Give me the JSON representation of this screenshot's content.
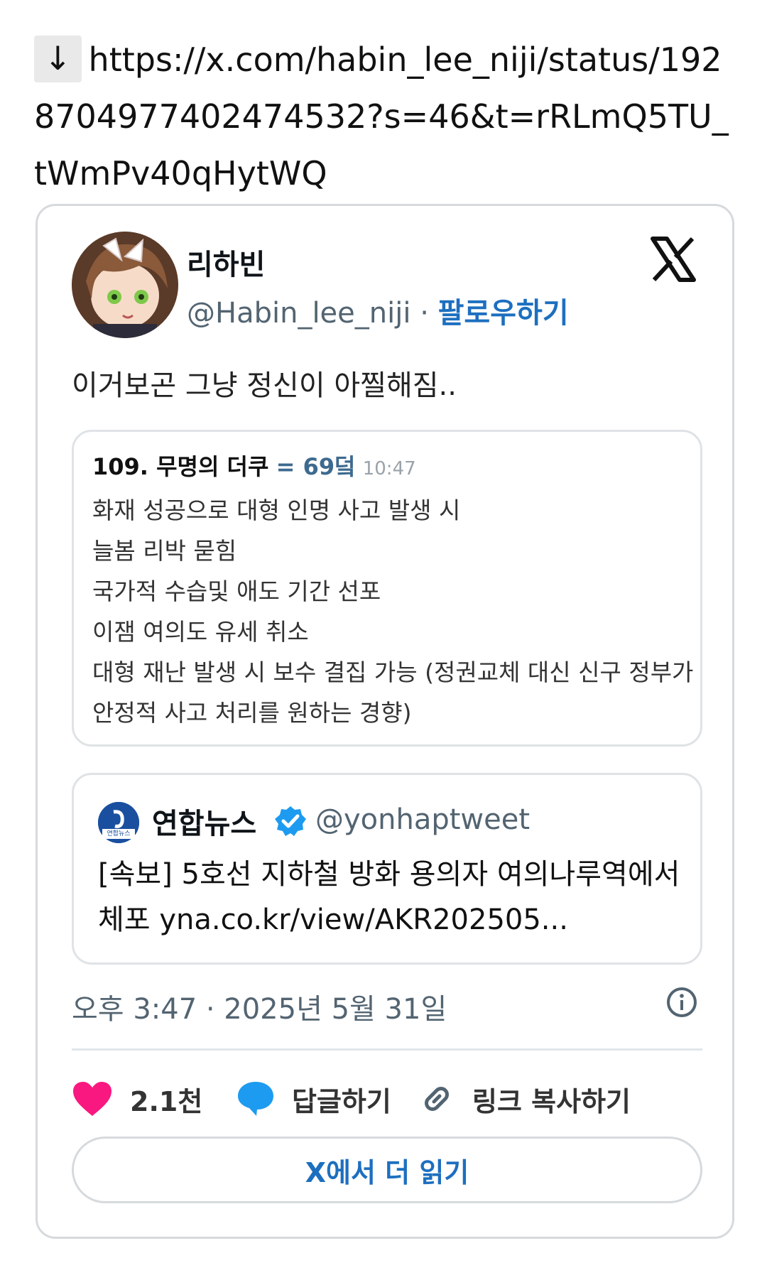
{
  "link": {
    "arrow": "↓",
    "url": "https://x.com/habin_lee_niji/status/1928704977402474532?s=46&t=rRLmQ5TU_tWmPv40qHytWQ"
  },
  "tweet": {
    "display_name": "리하빈",
    "handle": "@Habin_lee_niji",
    "separator": "·",
    "follow_label": "팔로우하기",
    "text": "이거보곤 그냥 정신이 아찔해짐..",
    "timestamp": "오후 3:47 · 2025년 5월 31일",
    "likes": "2.1천",
    "reply_label": "답글하기",
    "copy_link_label": "링크 복사하기",
    "read_more_label": "X에서 더 읽기",
    "avatar_icon": "anime-avatar-icon",
    "like_color": "#f91880",
    "link_color": "#1d6fbf"
  },
  "quote_image": {
    "number": "109. 무명의 더쿠",
    "score": "= 69덬",
    "time": "10:47",
    "lines": [
      "화재 성공으로 대형 인명 사고 발생 시",
      "늘봄 리박 묻힘",
      "국가적 수습및 애도 기간 선포",
      "이잼 여의도 유세 취소",
      "대형 재난 발생 시 보수 결집 가능 (정권교체 대신 신구 정부가",
      "안정적 사고 처리를 원하는 경향)"
    ]
  },
  "embedded": {
    "name": "연합뉴스",
    "handle": "@yonhaptweet",
    "logo_text": "연합뉴스",
    "text": "[속보] 5호선 지하철 방화 용의자 여의나루역에서 체포 yna.co.kr/view/AKR202505..."
  }
}
